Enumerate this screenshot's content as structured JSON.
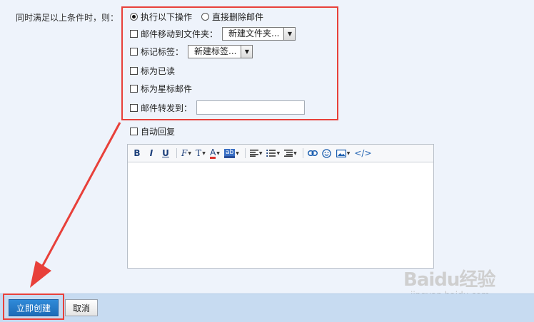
{
  "conditions_label": "同时满足以上条件时，则：",
  "action_mode": {
    "option_execute": "执行以下操作",
    "option_delete": "直接删除邮件",
    "selected": "option_execute"
  },
  "actions": {
    "move_to_folder": {
      "label": "邮件移动到文件夹：",
      "select_value": "新建文件夹..."
    },
    "mark_tag": {
      "label": "标记标签：",
      "select_value": "新建标签..."
    },
    "mark_read": {
      "label": "标为已读"
    },
    "mark_star": {
      "label": "标为星标邮件"
    },
    "forward_to": {
      "label": "邮件转发到：",
      "value": ""
    }
  },
  "auto_reply": {
    "label": "自动回复"
  },
  "editor_toolbar": {
    "bold": "B",
    "italic": "I",
    "underline": "U",
    "font_family": "F",
    "font_size": "T",
    "font_color": "A",
    "bg_color": "ab",
    "html_source": "</>",
    "icons": [
      "bold-icon",
      "italic-icon",
      "underline-icon",
      "font-family-icon",
      "font-size-icon",
      "font-color-icon",
      "background-color-icon",
      "align-icon",
      "unordered-list-icon",
      "indent-icon",
      "link-icon",
      "emoticon-icon",
      "image-icon",
      "html-source-icon"
    ]
  },
  "footer": {
    "create_button": "立即创建",
    "cancel_button": "取消"
  },
  "watermark": {
    "logo": "Baidu经验",
    "url": "jingyan.baidu.com"
  },
  "colors": {
    "highlight_red": "#e8403a",
    "primary_blue": "#1e6cb8",
    "footer_bg": "#c7dbf1",
    "page_bg": "#eef3fb"
  }
}
